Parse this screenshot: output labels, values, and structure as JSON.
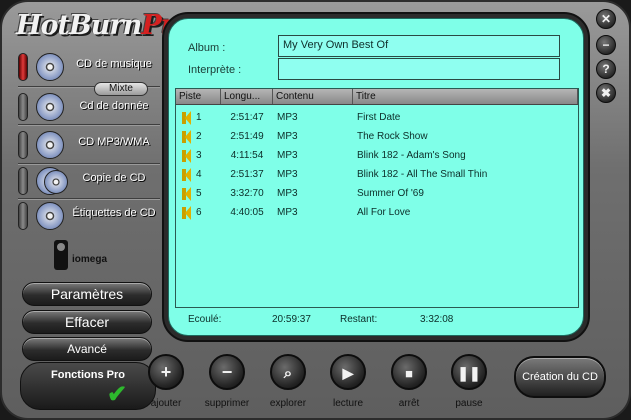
{
  "app": {
    "logo_main": "HotBurn",
    "logo_accent": "Pro"
  },
  "sidebar": {
    "items": [
      {
        "label": "CD de musique",
        "active": true
      },
      {
        "label": "Cd de donnée",
        "badge": "Mixte",
        "active": false
      },
      {
        "label": "CD MP3/WMA",
        "active": false
      },
      {
        "label": "Copie de CD",
        "active": false
      },
      {
        "label": "Étiquettes de CD",
        "active": false
      }
    ],
    "brand": "iomega",
    "buttons": {
      "parametres": "Paramètres",
      "effacer": "Effacer",
      "avance": "Avancé",
      "fonctions_pro": "Fonctions Pro"
    }
  },
  "album": {
    "album_label": "Album :",
    "album_value": "My Very Own Best Of",
    "interprete_label": "Interprète :",
    "interprete_value": ""
  },
  "tracklist": {
    "columns": [
      "Piste",
      "Longu...",
      "Contenu",
      "Titre"
    ],
    "rows": [
      {
        "piste": "1",
        "longueur": "2:51:47",
        "contenu": "MP3",
        "titre": "First Date"
      },
      {
        "piste": "2",
        "longueur": "2:51:49",
        "contenu": "MP3",
        "titre": "The Rock Show"
      },
      {
        "piste": "3",
        "longueur": "4:11:54",
        "contenu": "MP3",
        "titre": "Blink 182 - Adam's Song"
      },
      {
        "piste": "4",
        "longueur": "2:51:37",
        "contenu": "MP3",
        "titre": "Blink 182 - All The Small Thin"
      },
      {
        "piste": "5",
        "longueur": "3:32:70",
        "contenu": "MP3",
        "titre": "Summer Of '69"
      },
      {
        "piste": "6",
        "longueur": "4:40:05",
        "contenu": "MP3",
        "titre": "All For Love"
      }
    ]
  },
  "status": {
    "ecoule_label": "Ecoulé:",
    "ecoule_value": "20:59:37",
    "restant_label": "Restant:",
    "restant_value": "3:32:08"
  },
  "window_controls": {
    "close": "✕",
    "minimize": "−",
    "help": "?",
    "tools": "✖"
  },
  "transport": {
    "ajouter": "ajouter",
    "supprimer": "supprimer",
    "explorer": "explorer",
    "lecture": "lecture",
    "arret": "arrêt",
    "pause": "pause",
    "creation": "Création du CD"
  }
}
